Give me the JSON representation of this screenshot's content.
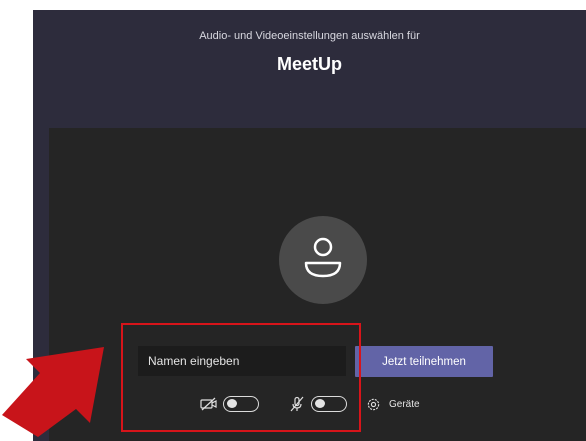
{
  "header": {
    "subtitle": "Audio- und Videoeinstellungen auswählen für",
    "title": "MeetUp"
  },
  "join": {
    "name_placeholder": "Namen eingeben",
    "join_label": "Jetzt teilnehmen"
  },
  "controls": {
    "camera_icon": "video-off-icon",
    "camera_toggle_state": "off",
    "mic_icon": "mic-off-icon",
    "mic_toggle_state": "off",
    "devices_icon": "gear-icon",
    "devices_label": "Geräte"
  },
  "colors": {
    "header_bg": "#2d2c3c",
    "preview_bg": "#252525",
    "accent": "#6264a7",
    "annotation": "#d7141a"
  }
}
